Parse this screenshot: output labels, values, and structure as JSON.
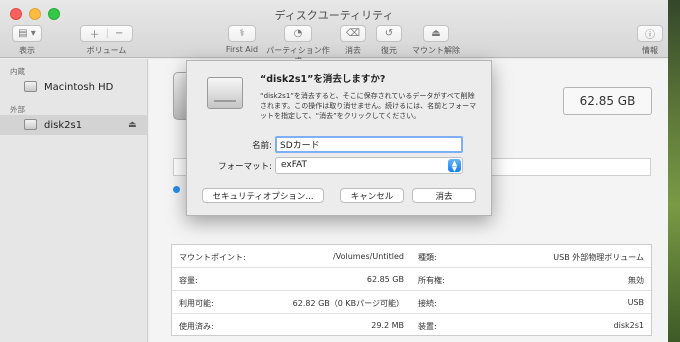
{
  "window": {
    "title": "ディスクユーティリティ"
  },
  "toolbar": {
    "view_label": "表示",
    "volume_label": "ボリューム",
    "first_aid_label": "First Aid",
    "partition_label": "パーティション作成",
    "erase_label": "消去",
    "restore_label": "復元",
    "unmount_label": "マウント解除",
    "info_label": "情報"
  },
  "sidebar": {
    "internal_header": "内蔵",
    "external_header": "外部",
    "items": [
      {
        "label": "Macintosh HD"
      },
      {
        "label": "disk2s1"
      }
    ]
  },
  "main": {
    "capacity": "62.85 GB"
  },
  "dialog": {
    "title": "“disk2s1”を消去しますか?",
    "message": "“disk2s1”を消去すると、そこに保存されているデータがすべて削除されます。この操作は取り消せません。続けるには、名前とフォーマットを指定して、“消去”をクリックしてください。",
    "name_label": "名前:",
    "name_value": "SDカード",
    "format_label": "フォーマット:",
    "format_value": "exFAT",
    "security_button": "セキュリティオプション...",
    "cancel_button": "キャンセル",
    "erase_button": "消去"
  },
  "info": {
    "rows": [
      {
        "label": "マウントポイント:",
        "value": "/Volumes/Untitled",
        "label2": "種類:",
        "value2": "USB 外部物理ボリューム"
      },
      {
        "label": "容量:",
        "value": "62.85 GB",
        "label2": "所有権:",
        "value2": "無効"
      },
      {
        "label": "利用可能:",
        "value": "62.82 GB（0 KBパージ可能）",
        "label2": "接続:",
        "value2": "USB"
      },
      {
        "label": "使用済み:",
        "value": "29.2 MB",
        "label2": "装置:",
        "value2": "disk2s1"
      }
    ]
  }
}
